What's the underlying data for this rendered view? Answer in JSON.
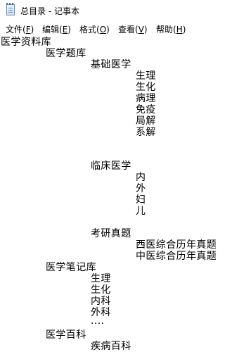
{
  "window": {
    "title": "总目录 - 记事本",
    "icon": "notepad-icon"
  },
  "menubar": {
    "items": [
      {
        "label": "文件(",
        "key": "F",
        "close": ")"
      },
      {
        "label": "编辑(",
        "key": "E",
        "close": ")"
      },
      {
        "label": "格式(",
        "key": "O",
        "close": ")"
      },
      {
        "label": "查看(",
        "key": "V",
        "close": ")"
      },
      {
        "label": "帮助(",
        "key": "H",
        "close": ")"
      }
    ]
  },
  "document": {
    "lines": [
      "医学资料库",
      "医学题库",
      "基础医学",
      "生理",
      "生化",
      "病理",
      "免疫",
      "局解",
      "系解",
      "临床医学",
      "内",
      "外",
      "妇",
      "儿",
      "考研真题",
      "西医综合历年真题",
      "中医综合历年真题",
      "医学笔记库",
      "生理",
      "生化",
      "内科",
      "外科",
      "····",
      "医学百科",
      "疾病百科"
    ]
  }
}
